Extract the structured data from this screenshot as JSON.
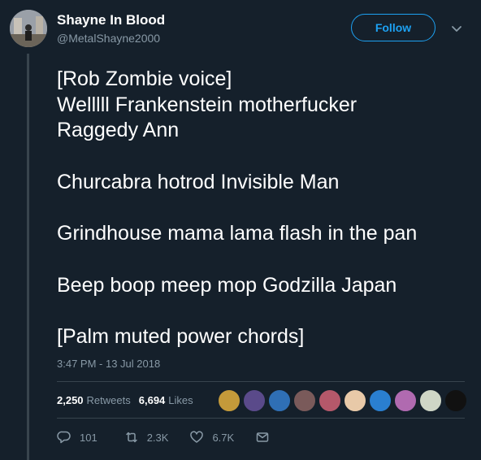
{
  "user": {
    "display_name": "Shayne In Blood",
    "handle": "@MetalShayne2000"
  },
  "follow_label": "Follow",
  "tweet_lines": [
    "[Rob Zombie voice]",
    "Welllll Frankenstein motherfucker",
    "Raggedy Ann",
    "",
    "Churcabra hotrod Invisible Man",
    "",
    "Grindhouse mama lama flash in the pan",
    "",
    "Beep boop meep mop Godzilla Japan",
    "",
    "[Palm muted power chords]"
  ],
  "timestamp": "3:47 PM - 13 Jul 2018",
  "stats": {
    "retweets_count": "2,250",
    "retweets_label": "Retweets",
    "likes_count": "6,694",
    "likes_label": "Likes"
  },
  "likers": [
    {
      "icon": "liker-avatar",
      "color": "#c49a3a"
    },
    {
      "icon": "liker-avatar",
      "color": "#5a4a8a"
    },
    {
      "icon": "liker-avatar",
      "color": "#2f6fb5"
    },
    {
      "icon": "liker-avatar",
      "color": "#7a5a5a"
    },
    {
      "icon": "liker-avatar",
      "color": "#b5586a"
    },
    {
      "icon": "liker-avatar",
      "color": "#e8c9a8"
    },
    {
      "icon": "liker-avatar",
      "color": "#2a7fd0"
    },
    {
      "icon": "liker-avatar",
      "color": "#b06ab0"
    },
    {
      "icon": "liker-avatar",
      "color": "#cfd6c6"
    },
    {
      "icon": "liker-avatar",
      "color": "#111111"
    }
  ],
  "actions": {
    "reply_count": "101",
    "retweet_count": "2.3K",
    "like_count": "6.7K"
  },
  "colors": {
    "background": "#15202b",
    "accent": "#1da1f2",
    "muted": "#8899a6",
    "divider": "#38444d"
  }
}
